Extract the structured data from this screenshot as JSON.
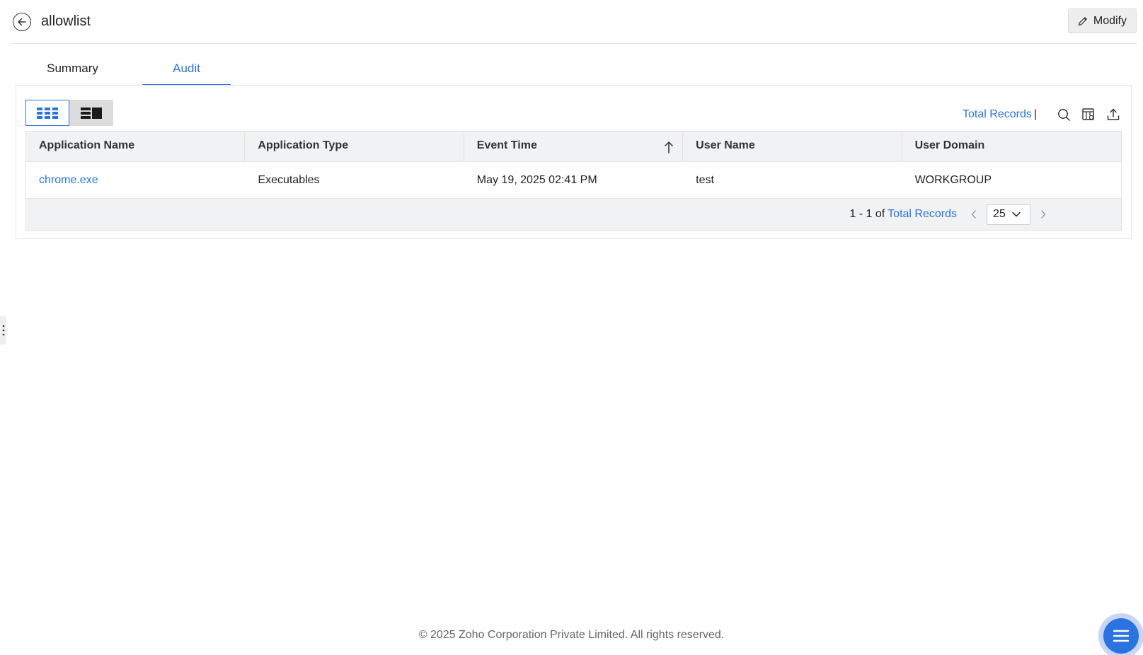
{
  "header": {
    "title": "allowlist",
    "modify_label": "Modify",
    "back_icon": "arrow-left-circle-icon",
    "modify_icon": "pencil-icon"
  },
  "tabs": [
    {
      "label": "Summary",
      "active": false
    },
    {
      "label": "Audit",
      "active": true
    }
  ],
  "toolbar": {
    "total_records_label": "Total Records",
    "separator": "|",
    "icons": [
      "search-icon",
      "column-settings-icon",
      "export-icon"
    ],
    "view_modes": [
      "grid-view-icon",
      "card-view-icon"
    ],
    "active_view": "grid"
  },
  "table": {
    "columns": [
      "Application Name",
      "Application Type",
      "Event Time",
      "User Name",
      "User Domain"
    ],
    "sorted_column": "Event Time",
    "sort_direction": "ascending",
    "rows": [
      {
        "application_name": "chrome.exe",
        "application_type": "Executables",
        "event_time": "May 19, 2025 02:41 PM",
        "user_name": "test",
        "user_domain": "WORKGROUP"
      }
    ]
  },
  "pagination": {
    "range": "1 - 1 of",
    "total_records_label": "Total Records",
    "page_size": "25"
  },
  "footer": {
    "copyright": "© 2025 Zoho Corporation Private Limited. All rights reserved."
  },
  "colors": {
    "accent": "#2b73e1",
    "header_bg": "#f1f2f4",
    "border": "#e3e3e3"
  }
}
